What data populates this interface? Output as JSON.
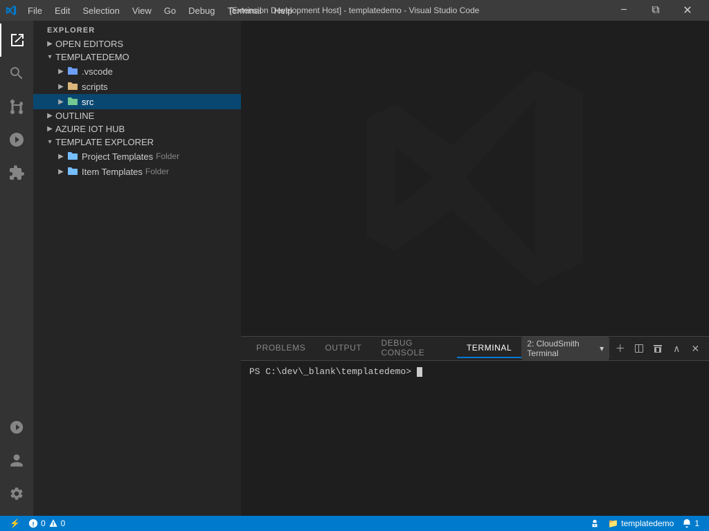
{
  "titlebar": {
    "title": "[Extension Development Host] - templatedemo - Visual Studio Code",
    "menu": [
      "File",
      "Edit",
      "Selection",
      "View",
      "Go",
      "Debug",
      "Terminal",
      "Help"
    ],
    "window_controls": [
      "−",
      "❐",
      "✕"
    ]
  },
  "activity_bar": {
    "icons": [
      {
        "name": "explorer-icon",
        "symbol": "⎘",
        "active": true
      },
      {
        "name": "search-icon",
        "symbol": "🔍"
      },
      {
        "name": "source-control-icon",
        "symbol": "⑂"
      },
      {
        "name": "debug-icon",
        "symbol": "▷"
      },
      {
        "name": "extensions-icon",
        "symbol": "⊞"
      }
    ],
    "bottom_icons": [
      {
        "name": "remote-icon",
        "symbol": "⌁"
      },
      {
        "name": "accounts-icon",
        "symbol": "👤"
      },
      {
        "name": "settings-icon",
        "symbol": "⚙"
      }
    ]
  },
  "sidebar": {
    "header": "EXPLORER",
    "sections": [
      {
        "id": "open-editors",
        "label": "OPEN EDITORS",
        "expanded": false
      },
      {
        "id": "templatedemo",
        "label": "TEMPLATEDEMO",
        "expanded": true,
        "children": [
          {
            "id": "vscode",
            "label": ".vscode",
            "type": "folder-blue",
            "expanded": false
          },
          {
            "id": "scripts",
            "label": "scripts",
            "type": "folder-plain",
            "expanded": false
          },
          {
            "id": "src",
            "label": "src",
            "type": "folder-green",
            "expanded": false,
            "selected": true
          }
        ]
      },
      {
        "id": "outline",
        "label": "OUTLINE",
        "expanded": false
      },
      {
        "id": "azure-iot-hub",
        "label": "AZURE IOT HUB",
        "expanded": false
      },
      {
        "id": "template-explorer",
        "label": "TEMPLATE EXPLORER",
        "expanded": true,
        "children": [
          {
            "id": "project-templates",
            "label": "Project Templates",
            "suffix": "Folder",
            "type": "template-folder"
          },
          {
            "id": "item-templates",
            "label": "Item Templates",
            "suffix": "Folder",
            "type": "template-folder"
          }
        ]
      }
    ]
  },
  "terminal": {
    "tabs": [
      "PROBLEMS",
      "OUTPUT",
      "DEBUG CONSOLE",
      "TERMINAL"
    ],
    "active_tab": "TERMINAL",
    "terminal_name": "2: CloudSmith Terminal",
    "prompt": "PS C:\\dev\\_blank\\templatedemo> ",
    "cursor": true
  },
  "statusbar": {
    "left": [
      {
        "text": "⚡",
        "name": "remote-status"
      },
      {
        "text": "⚠ 0",
        "name": "errors"
      },
      {
        "text": "⚠ 0",
        "name": "warnings"
      },
      {
        "text": "🔒",
        "name": "no-repo"
      }
    ],
    "right": [
      {
        "text": "templatedemo",
        "name": "folder-name"
      }
    ]
  },
  "colors": {
    "activity_bar_bg": "#333333",
    "sidebar_bg": "#252526",
    "editor_bg": "#1e1e1e",
    "titlebar_bg": "#3c3c3c",
    "terminal_tab_bar_bg": "#252526",
    "statusbar_bg": "#007acc",
    "selected_bg": "#094771",
    "accent": "#0078d4"
  }
}
